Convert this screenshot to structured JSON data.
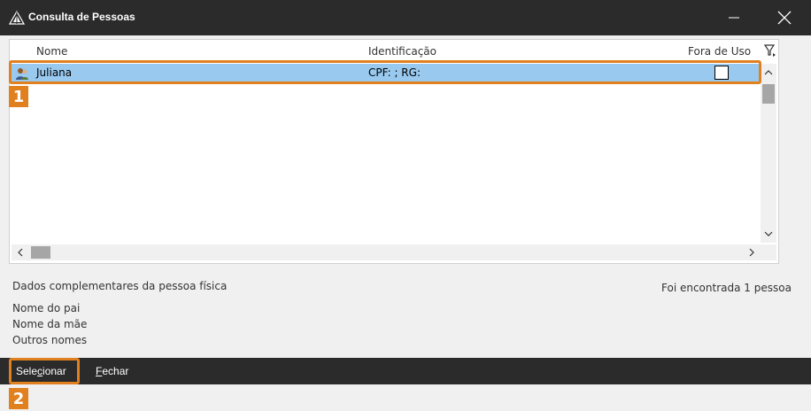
{
  "window": {
    "title": "Consulta de Pessoas",
    "icon": "app-logo-icon",
    "minimize_label": "—",
    "close_label": "✕"
  },
  "list": {
    "columns": [
      "Nome",
      "Identificação",
      "Fora de Uso"
    ],
    "filter_icon": "filter-icon",
    "rows": [
      {
        "icon": "person-icon",
        "name": "Juliana",
        "identification": "CPF:                    ; RG:",
        "fora_de_uso": false
      }
    ],
    "selected_row_color": "#99c9ef"
  },
  "scroll": {
    "up": "^",
    "down": "v",
    "left": "<",
    "right": ">"
  },
  "info": {
    "title": "Dados complementares da pessoa física",
    "count": "Foi encontrada 1 pessoa",
    "lines": [
      "Nome do pai",
      "Nome da mãe",
      "Outros nomes"
    ]
  },
  "actions": {
    "select_pre": "Sele",
    "select_ul": "c",
    "select_post": "ionar",
    "close_ul": "F",
    "close_post": "echar"
  },
  "callouts": [
    "1",
    "2"
  ],
  "colors": {
    "titlebar": "#2b2b2b",
    "accent": "#e0801f"
  }
}
